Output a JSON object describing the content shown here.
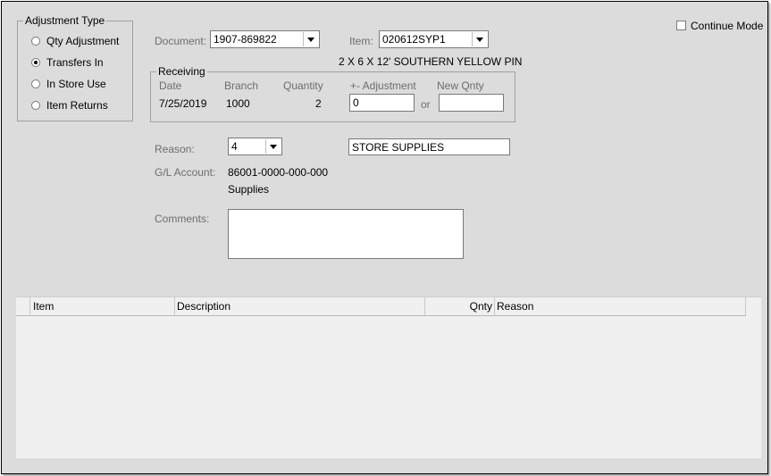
{
  "adjustment_type": {
    "legend": "Adjustment Type",
    "options": [
      {
        "label": "Qty Adjustment",
        "selected": false
      },
      {
        "label": "Transfers In",
        "selected": true
      },
      {
        "label": "In Store Use",
        "selected": false
      },
      {
        "label": "Item Returns",
        "selected": false
      }
    ]
  },
  "continue_mode": {
    "label": "Continue Mode",
    "checked": false
  },
  "document": {
    "label": "Document:",
    "value": "1907-869822"
  },
  "item": {
    "label": "Item:",
    "value": "020612SYP1",
    "description": "2 X 6 X 12' SOUTHERN YELLOW PIN"
  },
  "receiving": {
    "legend": "Receiving",
    "headers": {
      "date": "Date",
      "branch": "Branch",
      "quantity": "Quantity",
      "adjustment": "+- Adjustment",
      "new_qnty": "New Qnty"
    },
    "values": {
      "date": "7/25/2019",
      "branch": "1000",
      "quantity": "2",
      "adjustment": "0",
      "new_qnty": ""
    },
    "or_label": "or"
  },
  "reason": {
    "label": "Reason:",
    "code": "4",
    "description": "STORE SUPPLIES"
  },
  "gl_account": {
    "label": "G/L Account:",
    "value": "86001-0000-000-000",
    "name": "Supplies"
  },
  "comments": {
    "label": "Comments:",
    "value": ""
  },
  "grid": {
    "columns": [
      "Item",
      "Description",
      "Qnty",
      "Reason"
    ],
    "rows": []
  }
}
